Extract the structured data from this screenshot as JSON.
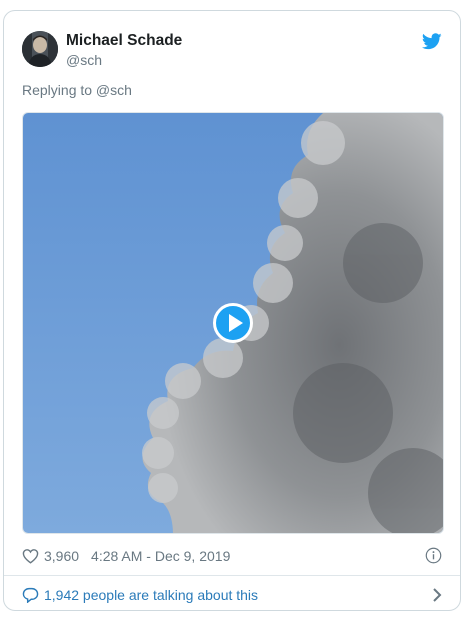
{
  "tweet": {
    "author_name": "Michael Schade",
    "author_handle": "@sch",
    "reply_text": "Replying to @sch",
    "like_count": "3,960",
    "timestamp": "4:28 AM - Dec 9, 2019",
    "talking_text": "1,942 people are talking about this"
  },
  "icons": {
    "brand": "twitter-bird-icon",
    "play": "play-icon",
    "like": "heart-icon",
    "info": "info-icon",
    "reply": "speech-bubble-icon",
    "next": "chevron-right-icon"
  },
  "colors": {
    "brand_blue": "#1da1f2",
    "link_blue": "#2b7bb9",
    "muted_text": "#697882",
    "sky_blue": "#6f9ed6"
  }
}
